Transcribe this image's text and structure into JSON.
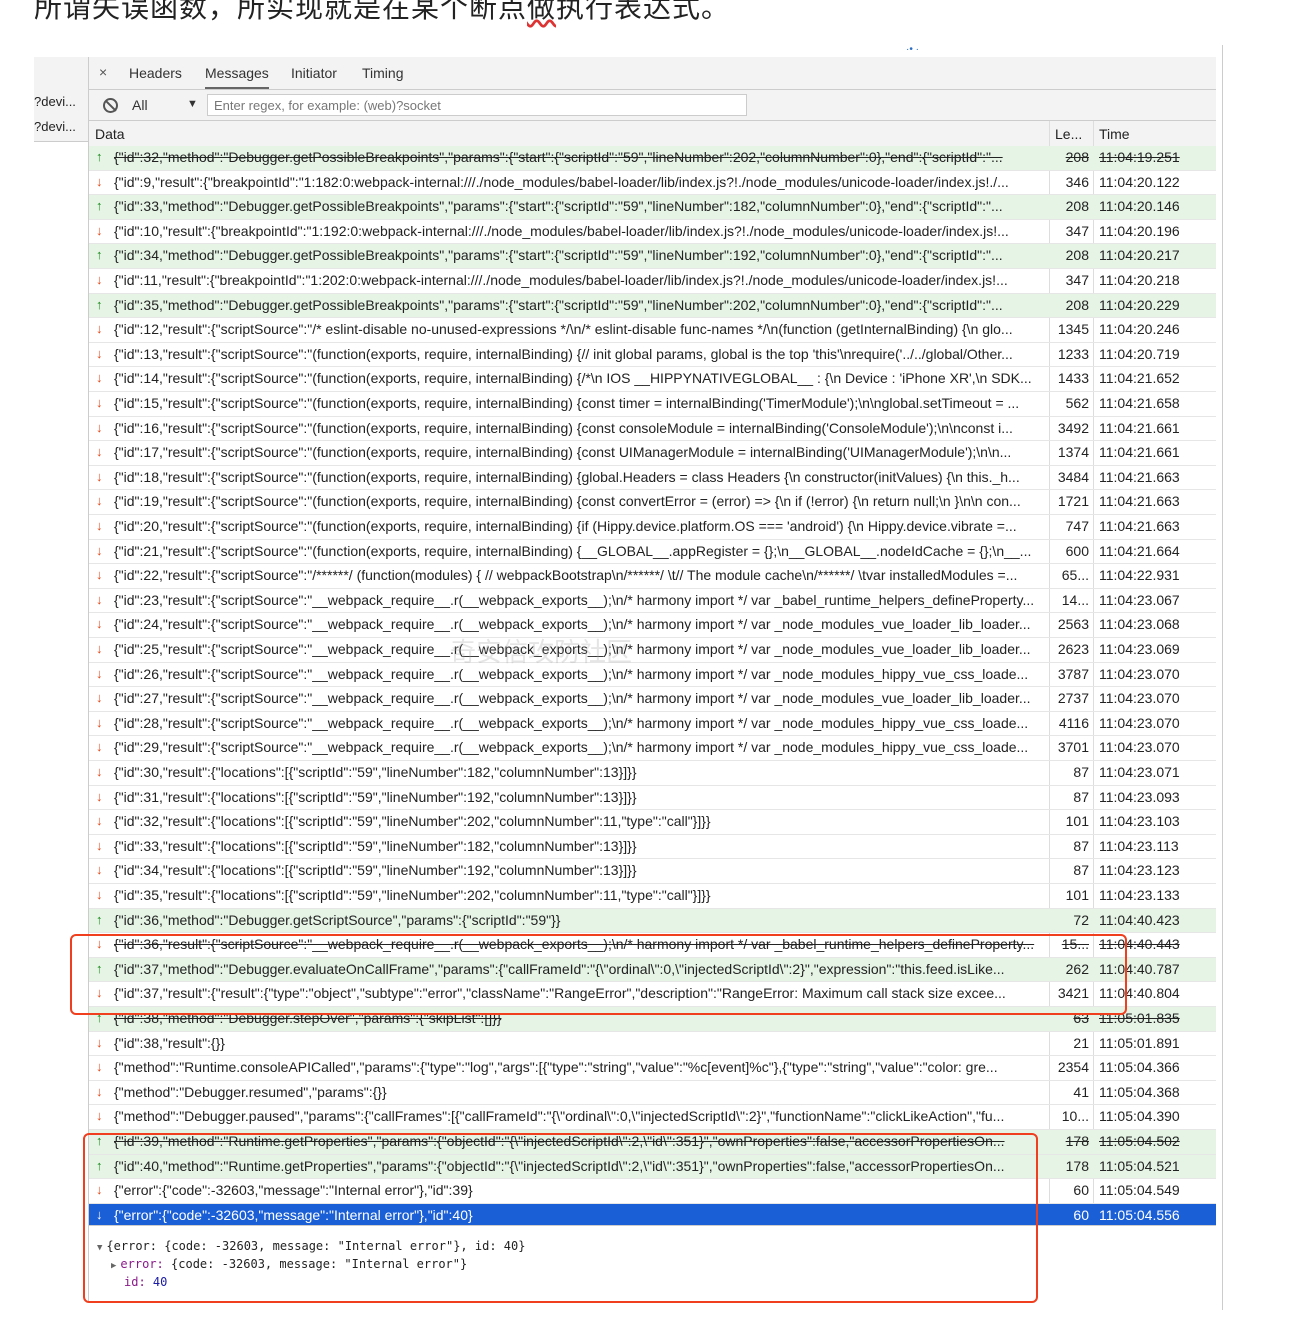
{
  "caption": {
    "text": "所谓失误函数，所实现就是在某个断点",
    "wavy_text": "做",
    "text_after": "执行表达式。"
  },
  "left_panel": {
    "items": [
      "?devi...",
      "?devi..."
    ]
  },
  "tabs": {
    "close": "×",
    "items": [
      "Headers",
      "Messages",
      "Initiator",
      "Timing"
    ],
    "active": "Messages"
  },
  "filter": {
    "type_label": "All",
    "type_arrow": "▼",
    "placeholder": "Enter regex, for example: (web)?socket"
  },
  "table": {
    "headers": {
      "data": "Data",
      "length": "Le...",
      "time": "Time"
    },
    "rows": [
      {
        "dir": "sent",
        "strike": true,
        "msg": "{\"id\":32,\"method\":\"Debugger.getPossibleBreakpoints\",\"params\":{\"start\":{\"scriptId\":\"59\",\"lineNumber\":202,\"columnNumber\":0},\"end\":{\"scriptId\":\"...",
        "len": "208",
        "time": "11:04:19.251"
      },
      {
        "dir": "recv",
        "msg": "{\"id\":9,\"result\":{\"breakpointId\":\"1:182:0:webpack-internal:///./node_modules/babel-loader/lib/index.js?!./node_modules/unicode-loader/index.js!./...",
        "len": "346",
        "time": "11:04:20.122"
      },
      {
        "dir": "sent",
        "msg": "{\"id\":33,\"method\":\"Debugger.getPossibleBreakpoints\",\"params\":{\"start\":{\"scriptId\":\"59\",\"lineNumber\":182,\"columnNumber\":0},\"end\":{\"scriptId\":\"...",
        "len": "208",
        "time": "11:04:20.146"
      },
      {
        "dir": "recv",
        "msg": "{\"id\":10,\"result\":{\"breakpointId\":\"1:192:0:webpack-internal:///./node_modules/babel-loader/lib/index.js?!./node_modules/unicode-loader/index.js!...",
        "len": "347",
        "time": "11:04:20.196"
      },
      {
        "dir": "sent",
        "msg": "{\"id\":34,\"method\":\"Debugger.getPossibleBreakpoints\",\"params\":{\"start\":{\"scriptId\":\"59\",\"lineNumber\":192,\"columnNumber\":0},\"end\":{\"scriptId\":\"...",
        "len": "208",
        "time": "11:04:20.217"
      },
      {
        "dir": "recv",
        "msg": "{\"id\":11,\"result\":{\"breakpointId\":\"1:202:0:webpack-internal:///./node_modules/babel-loader/lib/index.js?!./node_modules/unicode-loader/index.js!...",
        "len": "347",
        "time": "11:04:20.218"
      },
      {
        "dir": "sent",
        "msg": "{\"id\":35,\"method\":\"Debugger.getPossibleBreakpoints\",\"params\":{\"start\":{\"scriptId\":\"59\",\"lineNumber\":202,\"columnNumber\":0},\"end\":{\"scriptId\":\"...",
        "len": "208",
        "time": "11:04:20.229"
      },
      {
        "dir": "recv",
        "msg": "{\"id\":12,\"result\":{\"scriptSource\":\"/* eslint-disable no-unused-expressions */\\n/* eslint-disable func-names */\\n(function (getInternalBinding) {\\n glo...",
        "len": "1345",
        "time": "11:04:20.246"
      },
      {
        "dir": "recv",
        "msg": "{\"id\":13,\"result\":{\"scriptSource\":\"(function(exports, require, internalBinding) {// init global params, global is the top 'this'\\nrequire('../../global/Other...",
        "len": "1233",
        "time": "11:04:20.719"
      },
      {
        "dir": "recv",
        "msg": "{\"id\":14,\"result\":{\"scriptSource\":\"(function(exports, require, internalBinding) {/*\\n IOS __HIPPYNATIVEGLOBAL__ : {\\n Device : 'iPhone XR',\\n SDK...",
        "len": "1433",
        "time": "11:04:21.652"
      },
      {
        "dir": "recv",
        "msg": "{\"id\":15,\"result\":{\"scriptSource\":\"(function(exports, require, internalBinding) {const timer = internalBinding('TimerModule');\\n\\nglobal.setTimeout = ...",
        "len": "562",
        "time": "11:04:21.658"
      },
      {
        "dir": "recv",
        "msg": "{\"id\":16,\"result\":{\"scriptSource\":\"(function(exports, require, internalBinding) {const consoleModule = internalBinding('ConsoleModule');\\n\\nconst i...",
        "len": "3492",
        "time": "11:04:21.661"
      },
      {
        "dir": "recv",
        "msg": "{\"id\":17,\"result\":{\"scriptSource\":\"(function(exports, require, internalBinding) {const UIManagerModule = internalBinding('UIManagerModule');\\n\\n...",
        "len": "1374",
        "time": "11:04:21.661"
      },
      {
        "dir": "recv",
        "msg": "{\"id\":18,\"result\":{\"scriptSource\":\"(function(exports, require, internalBinding) {global.Headers = class Headers {\\n constructor(initValues) {\\n this._h...",
        "len": "3484",
        "time": "11:04:21.663"
      },
      {
        "dir": "recv",
        "msg": "{\"id\":19,\"result\":{\"scriptSource\":\"(function(exports, require, internalBinding) {const convertError = (error) => {\\n if (!error) {\\n return null;\\n }\\n\\n con...",
        "len": "1721",
        "time": "11:04:21.663"
      },
      {
        "dir": "recv",
        "msg": "{\"id\":20,\"result\":{\"scriptSource\":\"(function(exports, require, internalBinding) {if (Hippy.device.platform.OS === 'android') {\\n Hippy.device.vibrate =...",
        "len": "747",
        "time": "11:04:21.663"
      },
      {
        "dir": "recv",
        "msg": "{\"id\":21,\"result\":{\"scriptSource\":\"(function(exports, require, internalBinding) {__GLOBAL__.appRegister = {};\\n__GLOBAL__.nodeIdCache = {};\\n__...",
        "len": "600",
        "time": "11:04:21.664"
      },
      {
        "dir": "recv",
        "msg": "{\"id\":22,\"result\":{\"scriptSource\":\"/******/ (function(modules) { // webpackBootstrap\\n/******/ \\t// The module cache\\n/******/ \\tvar installedModules =...",
        "len": "65...",
        "time": "11:04:22.931"
      },
      {
        "dir": "recv",
        "msg": "{\"id\":23,\"result\":{\"scriptSource\":\"__webpack_require__.r(__webpack_exports__);\\n/* harmony import */ var _babel_runtime_helpers_defineProperty...",
        "len": "14...",
        "time": "11:04:23.067"
      },
      {
        "dir": "recv",
        "msg": "{\"id\":24,\"result\":{\"scriptSource\":\"__webpack_require__.r(__webpack_exports__);\\n/* harmony import */ var _node_modules_vue_loader_lib_loader...",
        "len": "2563",
        "time": "11:04:23.068"
      },
      {
        "dir": "recv",
        "msg": "{\"id\":25,\"result\":{\"scriptSource\":\"__webpack_require__.r(__webpack_exports__);\\n/* harmony import */ var _node_modules_vue_loader_lib_loader...",
        "len": "2623",
        "time": "11:04:23.069"
      },
      {
        "dir": "recv",
        "msg": "{\"id\":26,\"result\":{\"scriptSource\":\"__webpack_require__.r(__webpack_exports__);\\n/* harmony import */ var _node_modules_hippy_vue_css_loade...",
        "len": "3787",
        "time": "11:04:23.070"
      },
      {
        "dir": "recv",
        "msg": "{\"id\":27,\"result\":{\"scriptSource\":\"__webpack_require__.r(__webpack_exports__);\\n/* harmony import */ var _node_modules_vue_loader_lib_loader...",
        "len": "2737",
        "time": "11:04:23.070"
      },
      {
        "dir": "recv",
        "msg": "{\"id\":28,\"result\":{\"scriptSource\":\"__webpack_require__.r(__webpack_exports__);\\n/* harmony import */ var _node_modules_hippy_vue_css_loade...",
        "len": "4116",
        "time": "11:04:23.070"
      },
      {
        "dir": "recv",
        "msg": "{\"id\":29,\"result\":{\"scriptSource\":\"__webpack_require__.r(__webpack_exports__);\\n/* harmony import */ var _node_modules_hippy_vue_css_loade...",
        "len": "3701",
        "time": "11:04:23.070"
      },
      {
        "dir": "recv",
        "msg": "{\"id\":30,\"result\":{\"locations\":[{\"scriptId\":\"59\",\"lineNumber\":182,\"columnNumber\":13}]}}",
        "len": "87",
        "time": "11:04:23.071"
      },
      {
        "dir": "recv",
        "msg": "{\"id\":31,\"result\":{\"locations\":[{\"scriptId\":\"59\",\"lineNumber\":192,\"columnNumber\":13}]}}",
        "len": "87",
        "time": "11:04:23.093"
      },
      {
        "dir": "recv",
        "msg": "{\"id\":32,\"result\":{\"locations\":[{\"scriptId\":\"59\",\"lineNumber\":202,\"columnNumber\":11,\"type\":\"call\"}]}}",
        "len": "101",
        "time": "11:04:23.103"
      },
      {
        "dir": "recv",
        "msg": "{\"id\":33,\"result\":{\"locations\":[{\"scriptId\":\"59\",\"lineNumber\":182,\"columnNumber\":13}]}}",
        "len": "87",
        "time": "11:04:23.113"
      },
      {
        "dir": "recv",
        "msg": "{\"id\":34,\"result\":{\"locations\":[{\"scriptId\":\"59\",\"lineNumber\":192,\"columnNumber\":13}]}}",
        "len": "87",
        "time": "11:04:23.123"
      },
      {
        "dir": "recv",
        "msg": "{\"id\":35,\"result\":{\"locations\":[{\"scriptId\":\"59\",\"lineNumber\":202,\"columnNumber\":11,\"type\":\"call\"}]}}",
        "len": "101",
        "time": "11:04:23.133"
      },
      {
        "dir": "sent",
        "msg": "{\"id\":36,\"method\":\"Debugger.getScriptSource\",\"params\":{\"scriptId\":\"59\"}}",
        "len": "72",
        "time": "11:04:40.423"
      },
      {
        "dir": "recv",
        "strike": true,
        "msg": "{\"id\":36,\"result\":{\"scriptSource\":\"__webpack_require__.r(__webpack_exports__);\\n/* harmony import */ var _babel_runtime_helpers_defineProperty...",
        "len": "15...",
        "time": "11:04:40.443"
      },
      {
        "dir": "sent",
        "msg": "{\"id\":37,\"method\":\"Debugger.evaluateOnCallFrame\",\"params\":{\"callFrameId\":\"{\\\"ordinal\\\":0,\\\"injectedScriptId\\\":2}\",\"expression\":\"this.feed.isLike...",
        "len": "262",
        "time": "11:04:40.787"
      },
      {
        "dir": "recv",
        "msg": "{\"id\":37,\"result\":{\"result\":{\"type\":\"object\",\"subtype\":\"error\",\"className\":\"RangeError\",\"description\":\"RangeError: Maximum call stack size excee...",
        "len": "3421",
        "time": "11:04:40.804"
      },
      {
        "dir": "sent",
        "strike": true,
        "msg": "{\"id\":38,\"method\":\"Debugger.stepOver\",\"params\":{\"skipList\":[]}}",
        "len": "63",
        "time": "11:05:01.835"
      },
      {
        "dir": "recv",
        "msg": "{\"id\":38,\"result\":{}}",
        "len": "21",
        "time": "11:05:01.891"
      },
      {
        "dir": "recv",
        "msg": "{\"method\":\"Runtime.consoleAPICalled\",\"params\":{\"type\":\"log\",\"args\":[{\"type\":\"string\",\"value\":\"%c[event]%c\"},{\"type\":\"string\",\"value\":\"color: gre...",
        "len": "2354",
        "time": "11:05:04.366"
      },
      {
        "dir": "recv",
        "msg": "{\"method\":\"Debugger.resumed\",\"params\":{}}",
        "len": "41",
        "time": "11:05:04.368"
      },
      {
        "dir": "recv",
        "msg": "{\"method\":\"Debugger.paused\",\"params\":{\"callFrames\":[{\"callFrameId\":\"{\\\"ordinal\\\":0,\\\"injectedScriptId\\\":2}\",\"functionName\":\"clickLikeAction\",\"fu...",
        "len": "10...",
        "time": "11:05:04.390"
      },
      {
        "dir": "sent",
        "strike": true,
        "msg": "{\"id\":39,\"method\":\"Runtime.getProperties\",\"params\":{\"objectId\":\"{\\\"injectedScriptId\\\":2,\\\"id\\\":351}\",\"ownProperties\":false,\"accessorPropertiesOn...",
        "len": "178",
        "time": "11:05:04.502"
      },
      {
        "dir": "sent",
        "msg": "{\"id\":40,\"method\":\"Runtime.getProperties\",\"params\":{\"objectId\":\"{\\\"injectedScriptId\\\":2,\\\"id\\\":351}\",\"ownProperties\":false,\"accessorPropertiesOn...",
        "len": "178",
        "time": "11:05:04.521"
      },
      {
        "dir": "recv",
        "msg": "{\"error\":{\"code\":-32603,\"message\":\"Internal error\"},\"id\":39}",
        "len": "60",
        "time": "11:05:04.549"
      },
      {
        "dir": "recv",
        "selected": true,
        "msg": "{\"error\":{\"code\":-32603,\"message\":\"Internal error\"},\"id\":40}",
        "len": "60",
        "time": "11:05:04.556"
      }
    ]
  },
  "detail": {
    "line1": "{error: {code: -32603, message: \"Internal error\"}, id: 40}",
    "line2_key": "error:",
    "line2_val": "{code: -32603, message: \"Internal error\"}",
    "line3_key": "id:",
    "line3_val": "40"
  },
  "watermark": "奇安信攻防社区",
  "colors": {
    "sent_row": "#e6f4e6",
    "selected_row": "#1a5fd6",
    "sent_arrow": "#1a8a1a",
    "recv_arrow": "#e04a1a",
    "highlight_box": "#ef3f1f"
  }
}
